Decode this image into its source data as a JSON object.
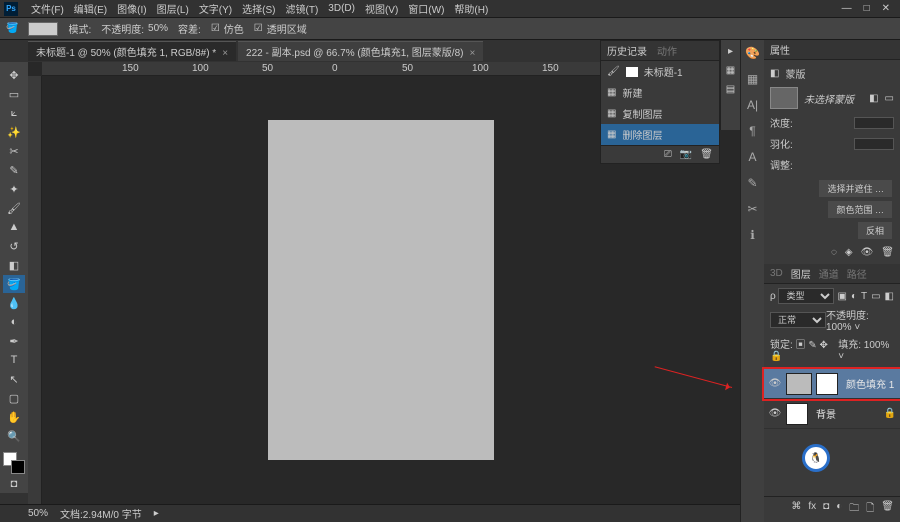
{
  "menu": [
    "文件(F)",
    "编辑(E)",
    "图像(I)",
    "图层(L)",
    "文字(Y)",
    "选择(S)",
    "滤镜(T)",
    "3D(D)",
    "视图(V)",
    "窗口(W)",
    "帮助(H)"
  ],
  "optionsbar": {
    "mode": "模式:",
    "opacity_label": "不透明度:",
    "opacity": "50%",
    "tolerance_label": "容差:",
    "antialias": "仿色",
    "transparent": "透明区域"
  },
  "tabs": {
    "a": "未标题-1 @ 50% (颜色填充 1, RGB/8#) *",
    "b": "222 - 副本.psd @ 66.7% (颜色填充1, 图层蒙版/8)"
  },
  "history": {
    "title": "历史记录",
    "alt": "动作",
    "doc": "未标题-1",
    "items": [
      "新建",
      "复制图层",
      "删除图层"
    ]
  },
  "properties": {
    "title": "属性",
    "icon_label": "蒙版",
    "no_sel": "未选择蒙版",
    "density_label": "浓度:",
    "feather_label": "羽化:",
    "edge_label": "调整:",
    "btn_pick": "选择并遮住 …",
    "btn_range": "颜色范围 …",
    "btn_invert": "反相"
  },
  "layers": {
    "tabs": [
      "3D",
      "图层",
      "通道",
      "路径"
    ],
    "kind": "类型",
    "blend": "正常",
    "opacity_label": "不透明度:",
    "opacity": "100%",
    "lock_label": "锁定:",
    "fill_label": "填充:",
    "fill": "100%",
    "layer1": "颜色填充 1",
    "layer2": "背景"
  },
  "status": {
    "zoom": "50%",
    "docinfo": "文档:2.94M/0 字节"
  },
  "ruler_marks": [
    "150",
    "100",
    "50",
    "0",
    "50",
    "100",
    "150"
  ]
}
